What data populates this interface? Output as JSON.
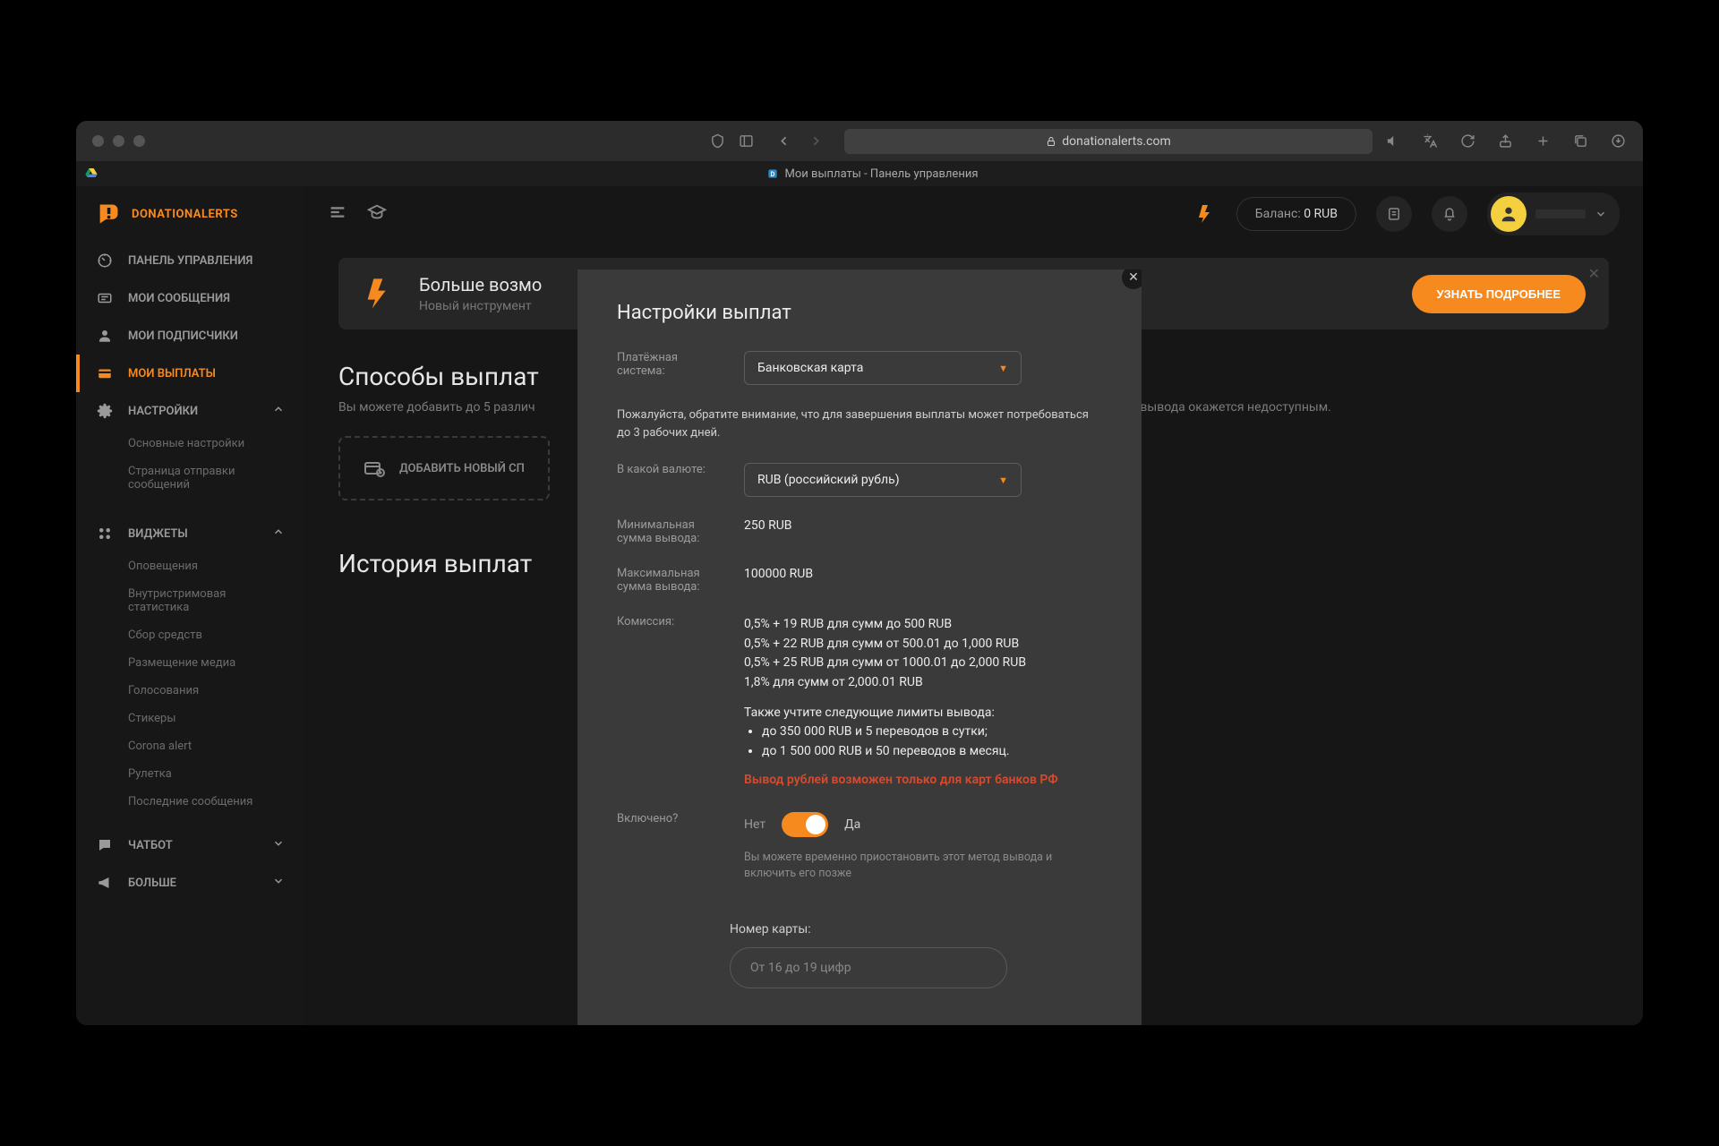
{
  "browser": {
    "url": "donationalerts.com",
    "tab_title": "Мои выплаты - Панель управления"
  },
  "brand": "DONATIONALERTS",
  "sidebar": {
    "items": [
      {
        "label": "ПАНЕЛЬ УПРАВЛЕНИЯ"
      },
      {
        "label": "МОИ СООБЩЕНИЯ"
      },
      {
        "label": "МОИ ПОДПИСЧИКИ"
      },
      {
        "label": "МОИ ВЫПЛАТЫ"
      },
      {
        "label": "НАСТРОЙКИ"
      }
    ],
    "settings_sub": [
      {
        "label": "Основные настройки"
      },
      {
        "label": "Страница отправки сообщений"
      }
    ],
    "widgets_label": "ВИДЖЕТЫ",
    "widgets_sub": [
      {
        "label": "Оповещения"
      },
      {
        "label": "Внутристримовая статистика"
      },
      {
        "label": "Сбор средств"
      },
      {
        "label": "Размещение медиа"
      },
      {
        "label": "Голосования"
      },
      {
        "label": "Стикеры"
      },
      {
        "label": "Corona alert"
      },
      {
        "label": "Рулетка"
      },
      {
        "label": "Последние сообщения"
      }
    ],
    "chatbot": "ЧАТБОТ",
    "more": "БОЛЬШЕ"
  },
  "topbar": {
    "balance_label": "Баланс:",
    "balance_value": "0 RUB"
  },
  "banner": {
    "title": "Больше возмо",
    "subtitle": "Новый инструмент",
    "button": "УЗНАТЬ ПОДРОБНЕЕ"
  },
  "sections": {
    "methods_title": "Способы выплат",
    "methods_sub_left": "Вы можете добавить до 5 различ",
    "methods_sub_right": "итетный способ вывода окажется недоступным.",
    "add_method": "ДОБАВИТЬ НОВЫЙ СП",
    "history_title": "История выплат"
  },
  "modal": {
    "title": "Настройки выплат",
    "payment_system_label": "Платёжная система:",
    "payment_system_value": "Банковская карта",
    "processing_note": "Пожалуйста, обратите внимание, что для завершения выплаты может потребоваться до 3 рабочих дней.",
    "currency_label": "В какой валюте:",
    "currency_value": "RUB (российский рубль)",
    "min_label": "Минимальная сумма вывода:",
    "min_value": "250 RUB",
    "max_label": "Максимальная сумма вывода:",
    "max_value": "100000 RUB",
    "fee_label": "Комиссия:",
    "fee_lines": [
      "0,5% + 19 RUB для сумм до 500 RUB",
      "0,5% + 22 RUB для сумм от 500.01 до 1,000 RUB",
      "0,5% + 25 RUB для сумм от 1000.01 до 2,000 RUB",
      "1,8% для сумм от 2,000.01 RUB"
    ],
    "limits_intro": "Также учтите следующие лимиты вывода:",
    "limits": [
      "до 350 000 RUB и 5 переводов в сутки;",
      "до 1 500 000 RUB и 50 переводов в месяц."
    ],
    "warning": "Вывод рублей возможен только для карт банков РФ",
    "enabled_label": "Включено?",
    "no": "Нет",
    "yes": "Да",
    "enabled_helper": "Вы можете временно приостановить этот метод вывода и включить его позже",
    "card_label": "Номер карты:",
    "card_placeholder": "От 16 до 19 цифр"
  }
}
